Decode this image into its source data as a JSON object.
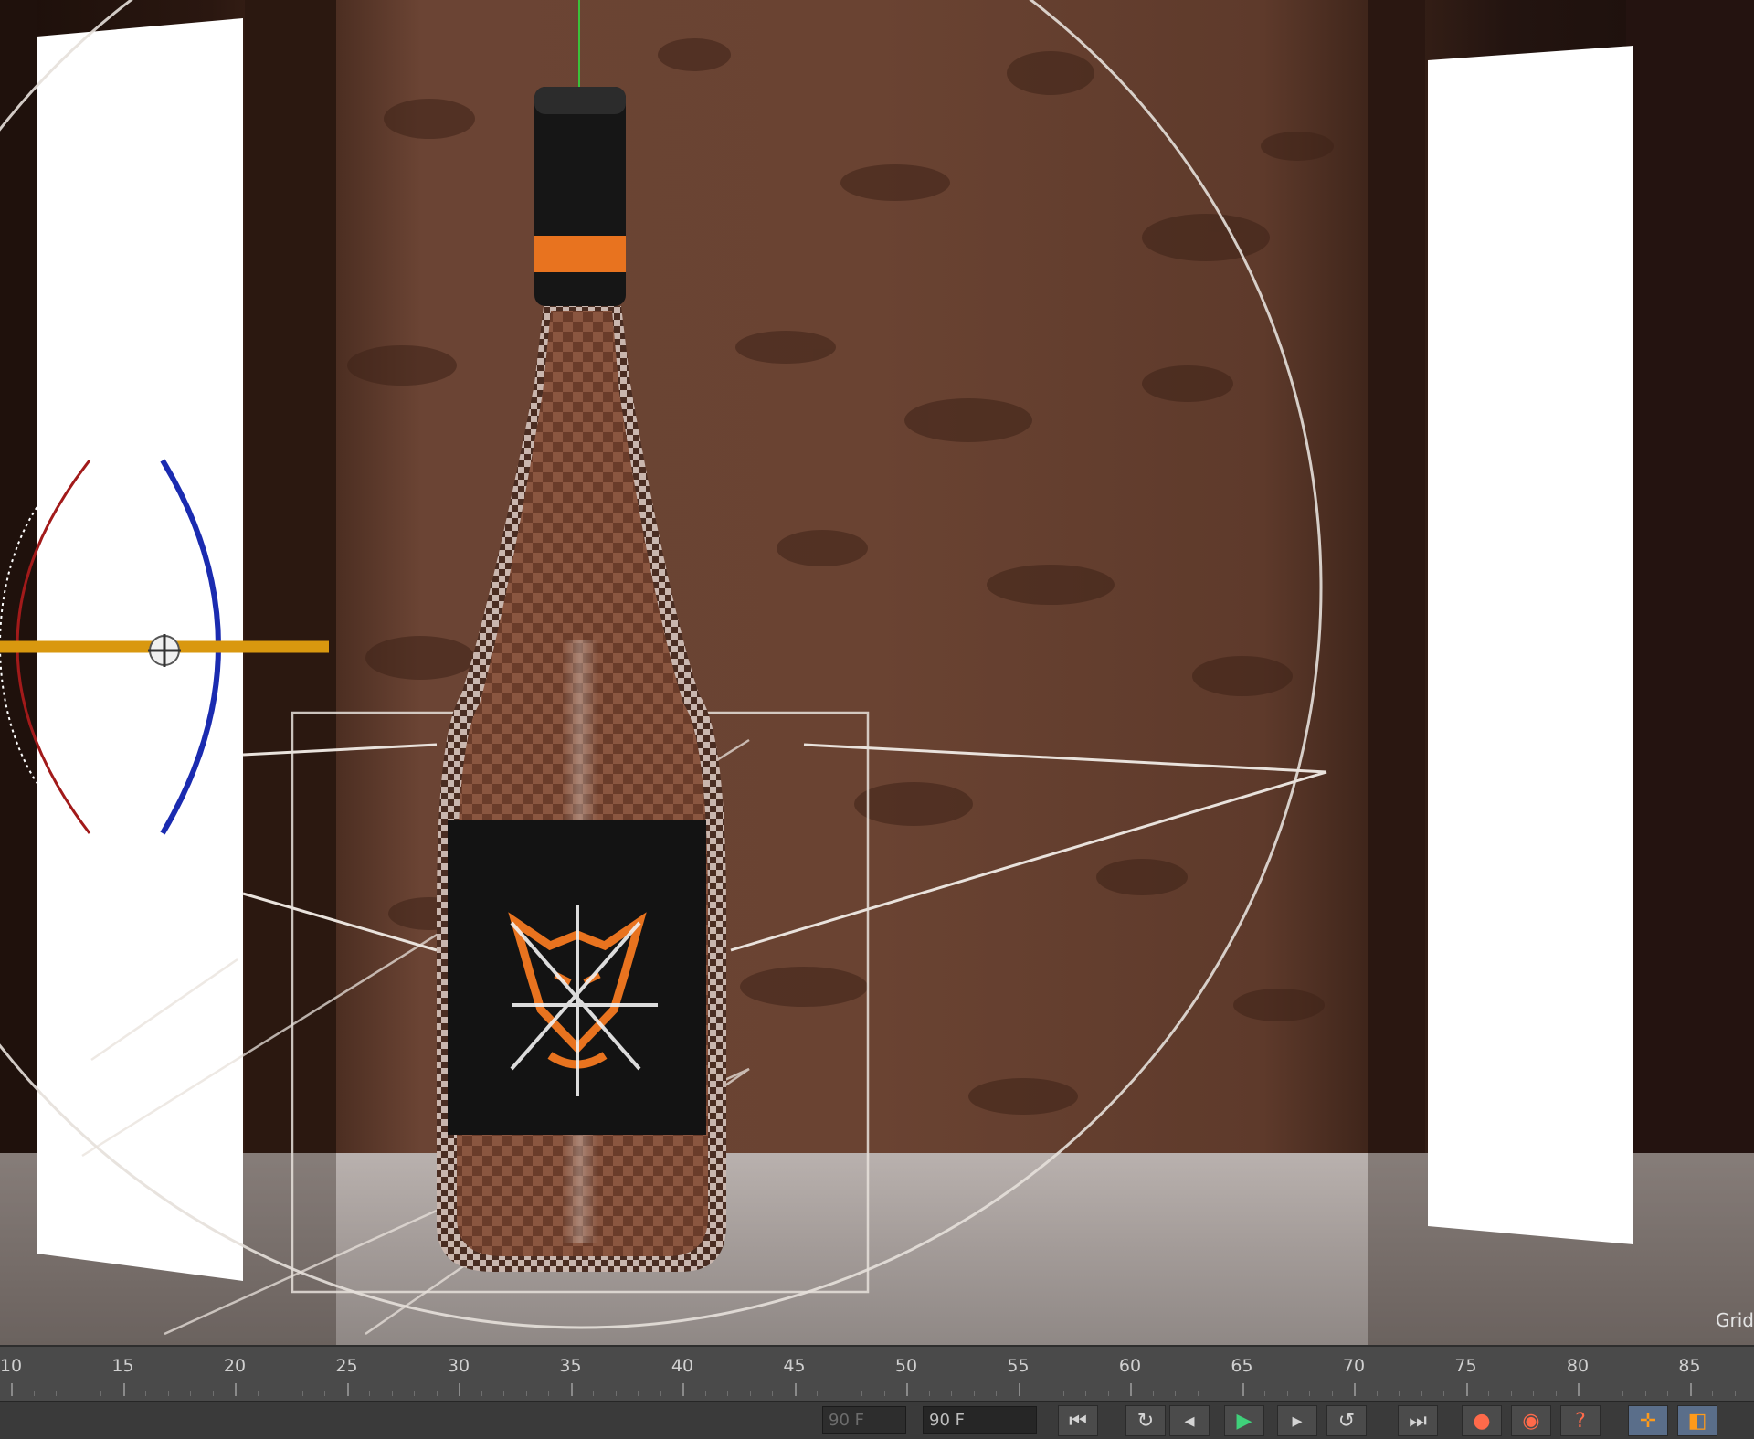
{
  "viewport": {
    "grid_label": "Grid"
  },
  "timeline": {
    "ticks": [
      "10",
      "15",
      "20",
      "25",
      "30",
      "35",
      "40",
      "45",
      "50",
      "55",
      "60",
      "65",
      "70",
      "75",
      "80",
      "85"
    ]
  },
  "toolbar": {
    "current_frame": "90 F",
    "end_frame": "90 F",
    "icons": [
      "go-to-start-icon",
      "loop-icon",
      "step-back-icon",
      "play-icon",
      "step-forward-icon",
      "loop-forward-icon",
      "go-to-end-icon",
      "record-keys-icon",
      "autokey-icon",
      "help-icon",
      "move-tool-icon",
      "scale-tool-icon"
    ]
  },
  "colors": {
    "accent_orange": "#e8731f",
    "axis_blue": "#1a2bb0",
    "axis_red": "#a21a1a",
    "selection_yellow": "#d9980f"
  }
}
